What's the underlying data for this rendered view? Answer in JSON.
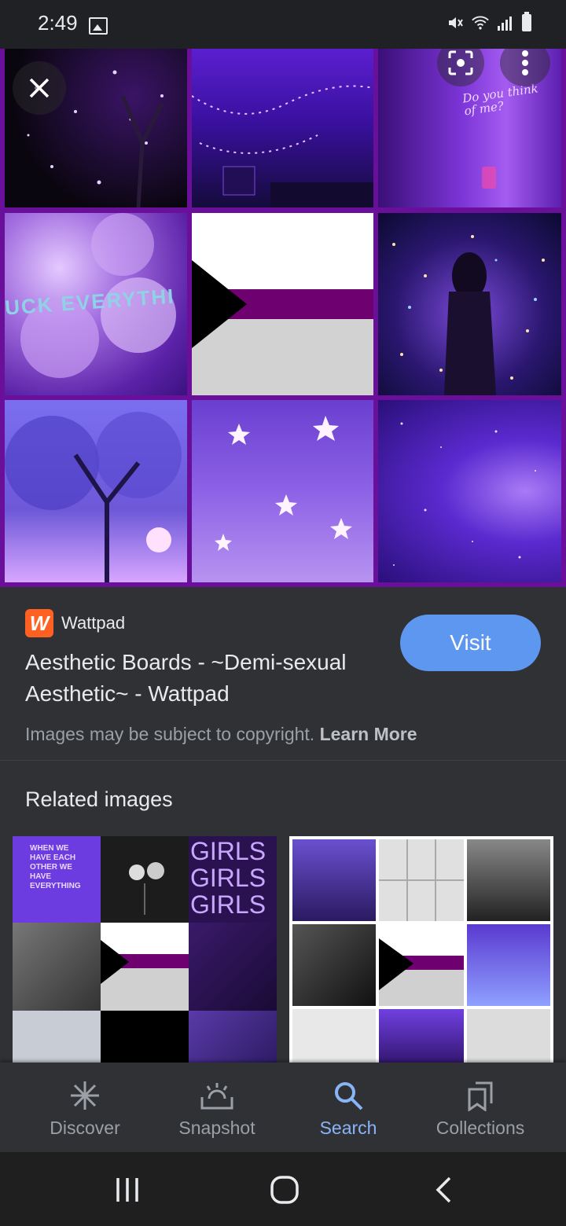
{
  "status_bar": {
    "time": "2:49"
  },
  "result": {
    "source": "Wattpad",
    "logo_letter": "W",
    "title": "Aesthetic Boards - ~Demi-sexual Aesthetic~ - Wattpad",
    "visit_label": "Visit",
    "copyright_text": "Images may be subject to copyright.",
    "learn_more": "Learn More",
    "tile_texts": {
      "cloud_text": "UCK EVERYTHI",
      "note_text": "Do you think of me?"
    }
  },
  "related": {
    "title": "Related images",
    "card1_neon": [
      "GIRLS",
      "GIRLS",
      "GIRLS"
    ],
    "card1_sign": "WHEN WE HAVE EACH OTHER WE HAVE EVERYTHING"
  },
  "bottom_nav": {
    "items": [
      {
        "label": "Discover",
        "icon": "asterisk-icon"
      },
      {
        "label": "Snapshot",
        "icon": "snapshot-icon"
      },
      {
        "label": "Search",
        "icon": "search-icon",
        "active": true
      },
      {
        "label": "Collections",
        "icon": "collections-icon"
      }
    ]
  },
  "colors": {
    "accent": "#8ab4f8",
    "visit_button": "#5e97f0",
    "brand_wattpad": "#ff6122",
    "demisexual_purple": "#6e0070"
  }
}
